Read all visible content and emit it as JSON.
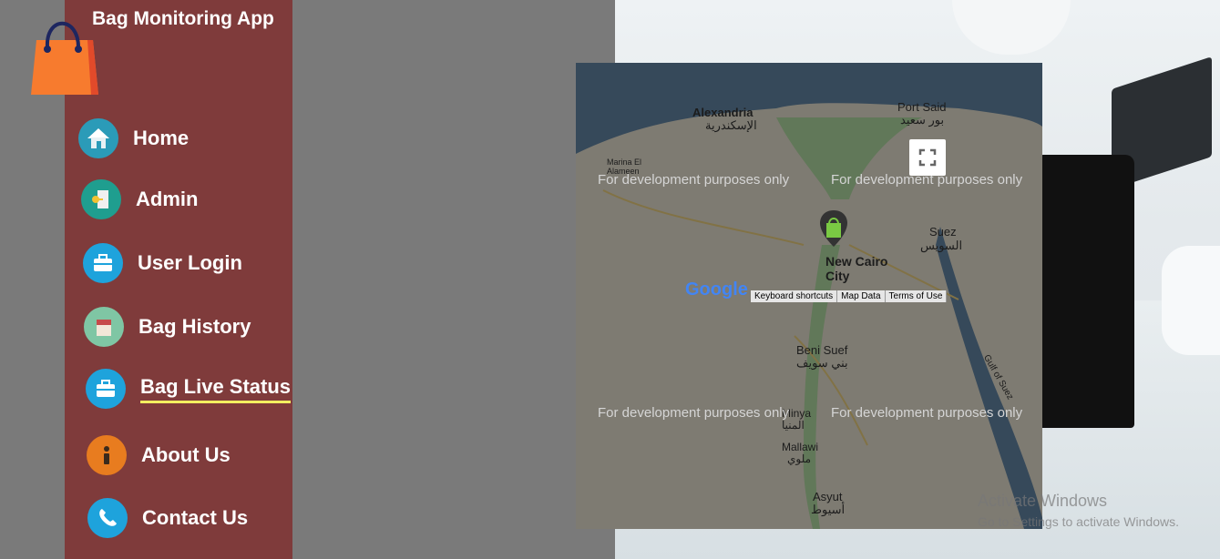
{
  "app": {
    "title": "Bag Monitoring App"
  },
  "nav": {
    "items": [
      {
        "label": "Home",
        "icon": "home-icon"
      },
      {
        "label": "Admin",
        "icon": "admin-key-icon"
      },
      {
        "label": "User Login",
        "icon": "briefcase-icon"
      },
      {
        "label": "Bag History",
        "icon": "bag-history-icon"
      },
      {
        "label": "Bag Live Status",
        "icon": "briefcase-icon",
        "active": true
      },
      {
        "label": "About Us",
        "icon": "info-icon"
      },
      {
        "label": "Contact Us",
        "icon": "phone-icon"
      }
    ]
  },
  "map": {
    "dev_watermark": "For development purposes only",
    "cities": {
      "alexandria": "Alexandria",
      "alexandria_ar": "الإسكندرية",
      "port_said": "Port Said",
      "port_said_ar": "بور سعيد",
      "marina": "Marina El Alameen",
      "suez": "Suez",
      "suez_ar": "السويس",
      "new_cairo": "New Cairo City",
      "beni_suef": "Beni Suef",
      "beni_suef_ar": "بني سويف",
      "minya": "Minya",
      "minya_ar": "المنيا",
      "mallawi": "Mallawi",
      "mallawi_ar": "ملوي",
      "asyut": "Asyut",
      "asyut_ar": "أسيوط",
      "gulf": "Gulf of Suez"
    },
    "google": "Google",
    "links": [
      "Keyboard shortcuts",
      "Map Data",
      "Terms of Use"
    ]
  },
  "os": {
    "activate_title": "Activate Windows",
    "activate_sub": "Go to Settings to activate Windows."
  }
}
